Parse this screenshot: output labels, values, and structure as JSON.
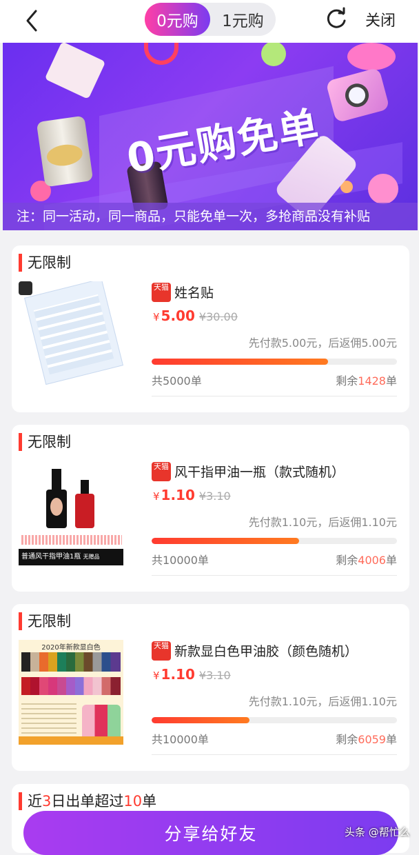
{
  "topbar": {
    "tabs": [
      {
        "label": "0元购",
        "active": true
      },
      {
        "label": "1元购",
        "active": false
      }
    ],
    "close_label": "关闭"
  },
  "banner": {
    "headline": "0元购免单",
    "notice": "注：同一活动，同一商品，只能免单一次，多抢商品没有补贴"
  },
  "products": [
    {
      "tag": "无限制",
      "platform": "天猫",
      "title": "姓名贴",
      "currency": "¥",
      "price": "5.00",
      "original_price": "¥30.00",
      "pay_note": "先付款5.00元，后返佣5.00元",
      "progress": 0.72,
      "total": "共5000单",
      "remain_label": "剩余",
      "remain_num": "1428",
      "remain_unit": "单"
    },
    {
      "tag": "无限制",
      "platform": "天猫",
      "title": "风干指甲油一瓶（款式随机）",
      "currency": "¥",
      "price": "1.10",
      "original_price": "¥3.10",
      "pay_note": "先付款1.10元，后返佣1.10元",
      "progress": 0.6,
      "total": "共10000单",
      "remain_label": "剩余",
      "remain_num": "4006",
      "remain_unit": "单"
    },
    {
      "tag": "无限制",
      "platform": "天猫",
      "title": "新款显白色甲油胶（颜色随机）",
      "currency": "¥",
      "price": "1.10",
      "original_price": "¥3.10",
      "pay_note": "先付款1.10元，后返佣1.10元",
      "progress": 0.4,
      "total": "共10000单",
      "remain_label": "剩余",
      "remain_num": "6059",
      "remain_unit": "单"
    }
  ],
  "section4": {
    "prefix": "近",
    "days": "3",
    "middle": "日出单超过",
    "count": "10",
    "suffix": "单"
  },
  "share_label": "分享给好友",
  "watermark": "头条 @帮忙么",
  "thumb_texts": {
    "p2_caption": "普通风干指甲油1瓶",
    "p2_caption2": "无赠品",
    "p3_header": "2020年新款显白色"
  },
  "colors": {
    "accent_red": "#ff3b30",
    "brand_purple": "#7b3cf0",
    "brand_pink": "#ff3fa6"
  }
}
